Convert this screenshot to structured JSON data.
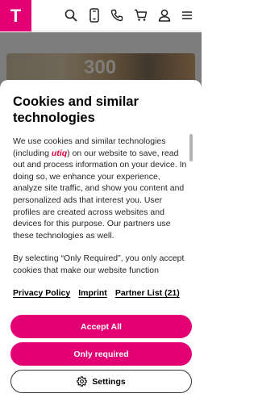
{
  "header": {
    "logo_text": "T",
    "brand_color": "#e20074",
    "icons": [
      "search-icon",
      "smartphone-icon",
      "phone-icon",
      "cart-icon",
      "user-icon",
      "menu-icon"
    ]
  },
  "background": {
    "hero_text": "300"
  },
  "consent": {
    "title": "Cookies and similar technologies",
    "paragraph1_pre": "We use cookies and similar technologies (including ",
    "utiq_logo_text": "utiq",
    "paragraph1_post": ") on our website to save, read out and process information on your device. In doing so, we enhance your experience, analyze site traffic, and show you content and personalized ads that interest you. User profiles are created across websites and devices for this purpose. Our partners use these technologies as well.",
    "paragraph2": "By selecting “Only Required”, you only accept cookies that make our website function properly. “Accept All” means that you allow access to information on your device and the use of all",
    "links": {
      "privacy_policy": "Privacy Policy",
      "imprint": "Imprint",
      "partner_list": "Partner List (21)"
    },
    "buttons": {
      "accept_all": "Accept All",
      "only_required": "Only required",
      "settings": "Settings"
    }
  }
}
